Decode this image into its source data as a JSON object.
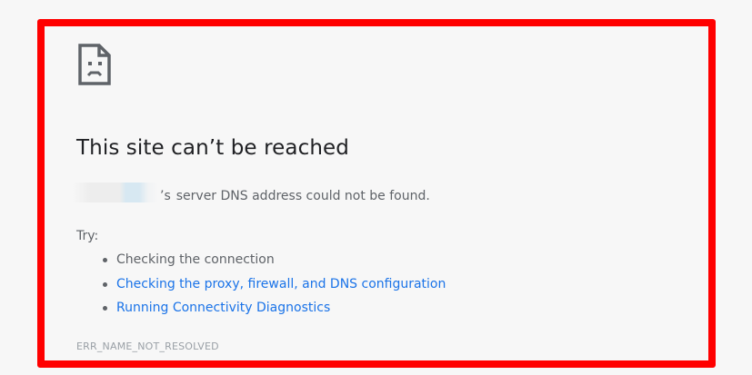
{
  "error_page": {
    "icon": "sad-document-icon",
    "title": "This site can’t be reached",
    "message_possessive": "’s",
    "message_text": "server DNS address could not be found.",
    "try_label": "Try:",
    "suggestions": [
      {
        "label": "Checking the connection",
        "is_link": false
      },
      {
        "label": "Checking the proxy, firewall, and DNS configuration",
        "is_link": true
      },
      {
        "label": "Running Connectivity Diagnostics",
        "is_link": true
      }
    ],
    "error_code": "ERR_NAME_NOT_RESOLVED"
  },
  "colors": {
    "highlight_border": "#ff0000",
    "background": "#f7f7f7",
    "title_text": "#202124",
    "body_text": "#5f6368",
    "link": "#1a73e8",
    "error_code_text": "#9aa0a6"
  }
}
